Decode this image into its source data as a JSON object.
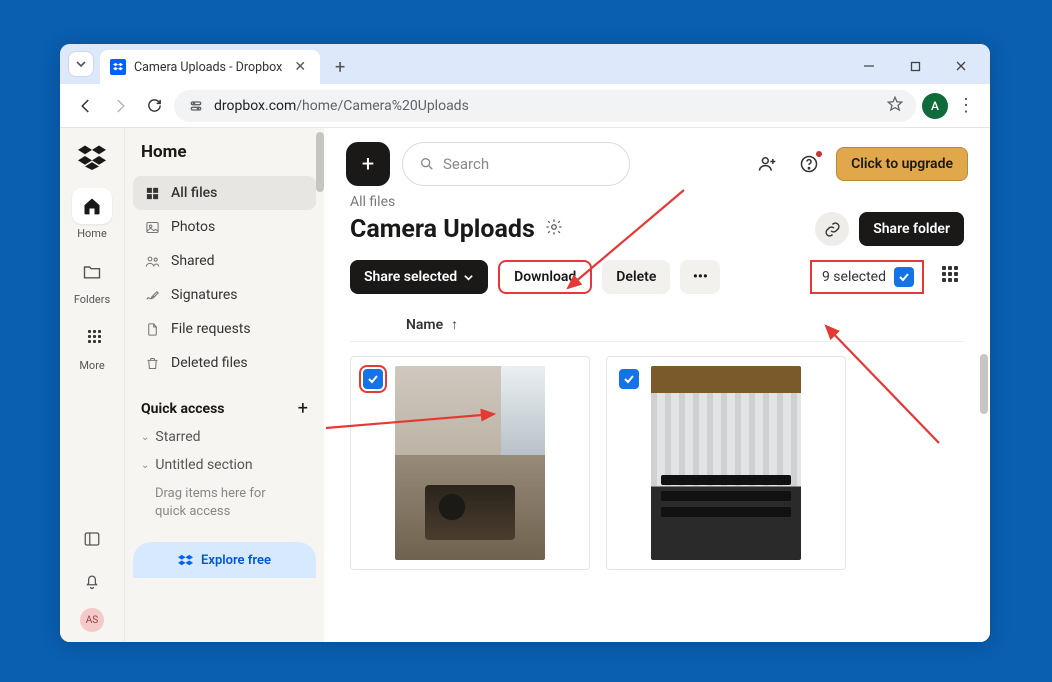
{
  "browser": {
    "tab_title": "Camera Uploads - Dropbox",
    "url_host": "dropbox.com",
    "url_path": "/home/Camera%20Uploads",
    "profile_initial": "A"
  },
  "rail": {
    "items": [
      {
        "label": "Home"
      },
      {
        "label": "Folders"
      },
      {
        "label": "More"
      }
    ],
    "user_initials": "AS"
  },
  "sidebar": {
    "title": "Home",
    "items": [
      {
        "label": "All files",
        "active": true
      },
      {
        "label": "Photos"
      },
      {
        "label": "Shared"
      },
      {
        "label": "Signatures"
      },
      {
        "label": "File requests"
      },
      {
        "label": "Deleted files"
      }
    ],
    "quick_access_label": "Quick access",
    "starred_label": "Starred",
    "untitled_label": "Untitled section",
    "quick_help": "Drag items here for quick access",
    "explore_label": "Explore free"
  },
  "top": {
    "search_placeholder": "Search",
    "upgrade_label": "Click to upgrade"
  },
  "header": {
    "breadcrumb": "All files",
    "title": "Camera Uploads",
    "share_folder": "Share folder"
  },
  "actions": {
    "share_selected": "Share selected",
    "download": "Download",
    "delete": "Delete",
    "selected_text": "9 selected"
  },
  "list": {
    "name_col": "Name"
  }
}
